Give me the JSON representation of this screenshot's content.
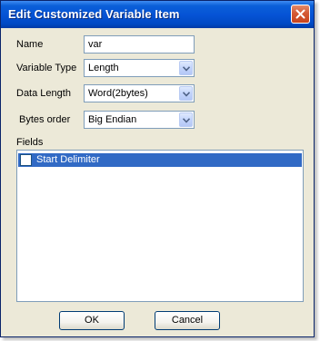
{
  "dialog": {
    "title": "Edit Customized Variable Item"
  },
  "form": {
    "name_label": "Name",
    "name_value": "var",
    "variable_type_label": "Variable Type",
    "variable_type_value": "Length",
    "data_length_label": "Data Length",
    "data_length_value": "Word(2bytes)",
    "bytes_order_label": "Bytes order",
    "bytes_order_value": "Big Endian"
  },
  "fields": {
    "label": "Fields",
    "items": [
      {
        "label": "Start Delimiter",
        "checked": false,
        "selected": true
      }
    ]
  },
  "buttons": {
    "ok": "OK",
    "cancel": "Cancel"
  },
  "icons": {
    "close": "close-icon",
    "dropdown": "chevron-down-icon"
  },
  "colors": {
    "titlebar": "#0a5fd8",
    "selection": "#316ac5",
    "dialog_bg": "#ece9d8",
    "close_button": "#d45a35"
  }
}
